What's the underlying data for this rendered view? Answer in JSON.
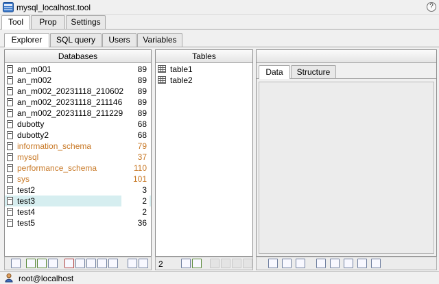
{
  "window": {
    "title": "mysql_localhost.tool",
    "help_glyph": "?"
  },
  "top_tabs": [
    {
      "label": "Tool",
      "active": true
    },
    {
      "label": "Prop",
      "active": false
    },
    {
      "label": "Settings",
      "active": false
    }
  ],
  "sub_tabs": [
    {
      "label": "Explorer",
      "active": true
    },
    {
      "label": "SQL query",
      "active": false
    },
    {
      "label": "Users",
      "active": false
    },
    {
      "label": "Variables",
      "active": false
    }
  ],
  "databases": {
    "header": "Databases",
    "items": [
      {
        "name": "an_m001",
        "count": "89",
        "system": false
      },
      {
        "name": "an_m002",
        "count": "89",
        "system": false
      },
      {
        "name": "an_m002_20231118_210602",
        "count": "89",
        "system": false
      },
      {
        "name": "an_m002_20231118_211146",
        "count": "89",
        "system": false
      },
      {
        "name": "an_m002_20231118_211229",
        "count": "89",
        "system": false
      },
      {
        "name": "dubotty",
        "count": "68",
        "system": false
      },
      {
        "name": "dubotty2",
        "count": "68",
        "system": false
      },
      {
        "name": "information_schema",
        "count": "79",
        "system": true
      },
      {
        "name": "mysql",
        "count": "37",
        "system": true
      },
      {
        "name": "performance_schema",
        "count": "110",
        "system": true
      },
      {
        "name": "sys",
        "count": "101",
        "system": true
      },
      {
        "name": "test2",
        "count": "3",
        "system": false
      },
      {
        "name": "test3",
        "count": "2",
        "system": false,
        "selected": true
      },
      {
        "name": "test4",
        "count": "2",
        "system": false
      },
      {
        "name": "test5",
        "count": "36",
        "system": false
      }
    ],
    "system_color": "#c87825",
    "selected_color": "#d6eef0"
  },
  "tables": {
    "header": "Tables",
    "items": [
      {
        "name": "table1"
      },
      {
        "name": "table2"
      }
    ],
    "count": "2"
  },
  "detail": {
    "header": "",
    "tabs": [
      {
        "label": "Data",
        "active": true
      },
      {
        "label": "Structure",
        "active": false
      }
    ]
  },
  "status": {
    "user": "root@localhost"
  }
}
